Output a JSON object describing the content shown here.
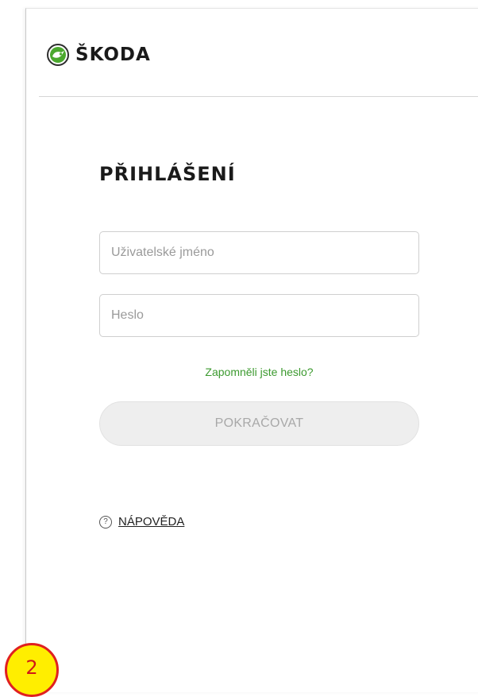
{
  "header": {
    "logo_icon": "skoda-arrow-icon",
    "brand_name": "ŠKODA",
    "brand_color": "#4ba82e"
  },
  "login": {
    "title": "PŘIHLÁŠENÍ",
    "username_placeholder": "Uživatelské jméno",
    "username_value": "",
    "password_placeholder": "Heslo",
    "password_value": "",
    "forgot_link": "Zapomněli jste heslo?",
    "continue_label": "POKRAČOVAT",
    "link_color": "#3c9a2f"
  },
  "help": {
    "icon": "question-circle-icon",
    "icon_glyph": "?",
    "label": "NÁPOVĚDA"
  },
  "annotation": {
    "step_number": "2",
    "badge_color": "#ffee00",
    "badge_border_color": "#e02020"
  }
}
